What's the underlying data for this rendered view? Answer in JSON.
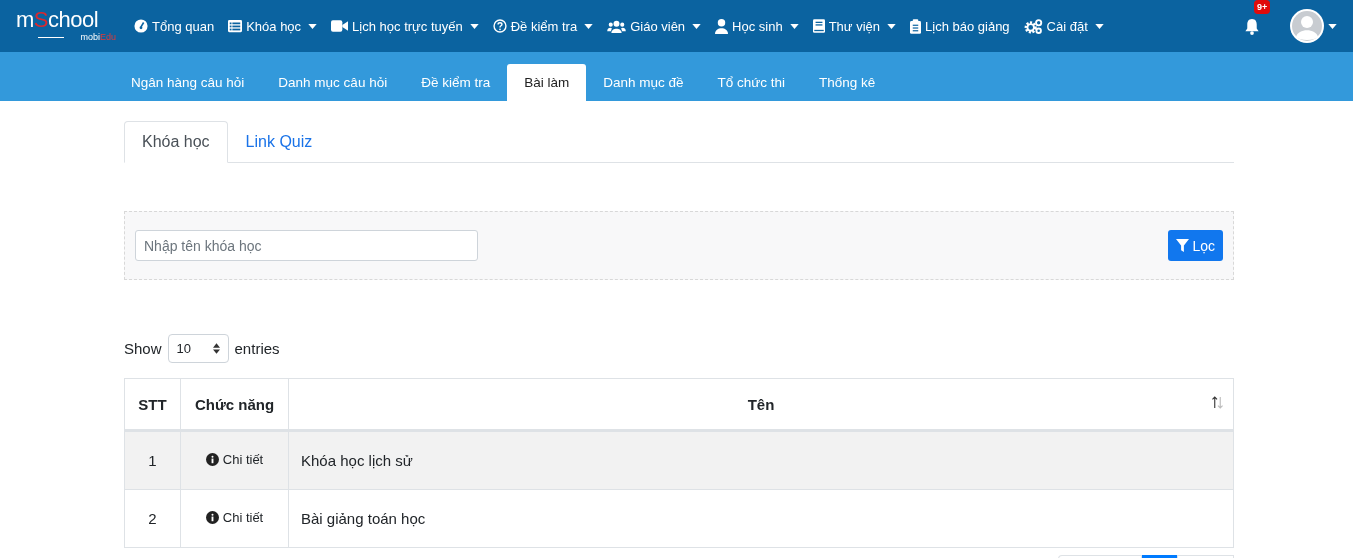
{
  "logo": {
    "main": [
      {
        "text": "m",
        "accent": false
      },
      {
        "text": "S",
        "accent": true
      },
      {
        "text": "chool",
        "accent": false
      }
    ],
    "sub": [
      {
        "text": "mobi",
        "accent": false
      },
      {
        "text": "Edu",
        "accent": true
      }
    ]
  },
  "nav": [
    {
      "label": "Tổng quan",
      "dropdown": false
    },
    {
      "label": "Khóa học",
      "dropdown": true
    },
    {
      "label": "Lịch học trực tuyến",
      "dropdown": true
    },
    {
      "label": "Đề kiểm tra",
      "dropdown": true
    },
    {
      "label": "Giáo viên",
      "dropdown": true
    },
    {
      "label": "Học sinh",
      "dropdown": true
    },
    {
      "label": "Thư viện",
      "dropdown": true
    },
    {
      "label": "Lịch báo giảng",
      "dropdown": false
    },
    {
      "label": "Cài đặt",
      "dropdown": true
    }
  ],
  "notifications": {
    "badge": "9+"
  },
  "subnav": [
    {
      "label": "Ngân hàng câu hỏi",
      "selected": false
    },
    {
      "label": "Danh mục câu hỏi",
      "selected": false
    },
    {
      "label": "Đề kiểm tra",
      "selected": false
    },
    {
      "label": "Bài làm",
      "selected": true
    },
    {
      "label": "Danh mục đề",
      "selected": false
    },
    {
      "label": "Tổ chức thi",
      "selected": false
    },
    {
      "label": "Thống kê",
      "selected": false
    }
  ],
  "tabs": [
    {
      "label": "Khóa học",
      "selected": true
    },
    {
      "label": "Link Quiz",
      "selected": false
    }
  ],
  "filter": {
    "search": {
      "placeholder": "Nhập tên khóa học"
    },
    "button": "Lọc"
  },
  "length": {
    "before": "Show",
    "value": "10",
    "after": "entries"
  },
  "table": {
    "columns": [
      "STT",
      "Chức năng",
      "Tên"
    ],
    "rows": [
      {
        "index": "1",
        "action": "Chi tiết",
        "name": "Khóa học lịch sử"
      },
      {
        "index": "2",
        "action": "Chi tiết",
        "name": "Bài giảng toán học"
      }
    ]
  },
  "pagination": {
    "pages": [
      {
        "selected": false
      },
      {
        "selected": true
      },
      {
        "selected": false
      }
    ]
  }
}
